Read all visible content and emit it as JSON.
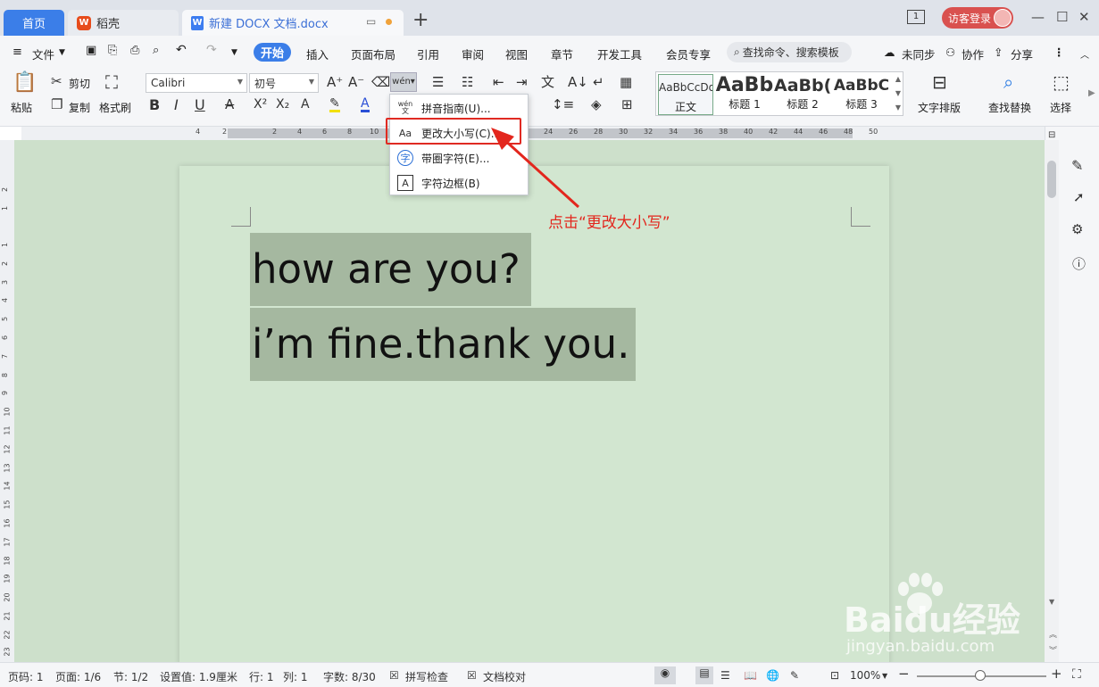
{
  "titlebar": {
    "tab_home": "首页",
    "tab_wps": "稻壳",
    "tab_doc": "新建 DOCX 文档.docx",
    "login": "访客登录",
    "window_num": "1"
  },
  "menu": {
    "file": "文件",
    "items": [
      "开始",
      "插入",
      "页面布局",
      "引用",
      "审阅",
      "视图",
      "章节",
      "开发工具",
      "会员专享"
    ],
    "search_placeholder": "查找命令、搜索模板",
    "sync": "未同步",
    "collab": "协作",
    "share": "分享"
  },
  "ribbon": {
    "paste": "粘贴",
    "cut": "剪切",
    "copy": "复制",
    "format_painter": "格式刷",
    "font_name": "Calibri",
    "font_size": "初号",
    "bold": "B",
    "italic": "I",
    "underline": "U",
    "styles": [
      {
        "preview": "AaBbCcDd",
        "name": "正文"
      },
      {
        "preview": "AaBb",
        "name": "标题 1"
      },
      {
        "preview": "AaBb(",
        "name": "标题 2"
      },
      {
        "preview": "AaBbC",
        "name": "标题 3"
      }
    ],
    "text_layout": "文字排版",
    "find_replace": "查找替换",
    "select": "选择"
  },
  "dropdown": {
    "items": [
      {
        "icon": "wén 文",
        "label": "拼音指南(U)..."
      },
      {
        "icon": "Aa",
        "label": "更改大小写(C)..."
      },
      {
        "icon": "字",
        "label": "带圈字符(E)..."
      },
      {
        "icon": "A",
        "label": "字符边框(B)"
      }
    ]
  },
  "annotation": "点击“更改大小写”",
  "document": {
    "lines": [
      "how are you?",
      "i’m fine.thank you."
    ]
  },
  "ruler": {
    "top": [
      "4",
      "2",
      "2",
      "4",
      "6",
      "8",
      "10",
      "24",
      "26",
      "28",
      "30",
      "32",
      "34",
      "36",
      "38",
      "40",
      "42",
      "44",
      "46",
      "48",
      "50"
    ],
    "left": [
      "2",
      "1",
      "1",
      "2",
      "3",
      "4",
      "5",
      "6",
      "7",
      "8",
      "9",
      "10",
      "11",
      "12",
      "13",
      "14",
      "15",
      "16",
      "17",
      "18",
      "19",
      "20",
      "21",
      "22",
      "23"
    ]
  },
  "status": {
    "page_no": "页码: 1",
    "pages": "页面: 1/6",
    "section": "节: 1/2",
    "setting": "设置值: 1.9厘米",
    "row": "行: 1",
    "col": "列: 1",
    "words": "字数: 8/30",
    "spell": "拼写检查",
    "proof": "文档校对",
    "zoom": "100%"
  },
  "watermark": {
    "brand": "Baidu经验",
    "url": "jingyan.baidu.com"
  },
  "colors": {
    "accent": "#3b7ee8",
    "highlight_red": "#e02a22",
    "doc_bg": "#d2e6d0",
    "selection": "#a5b8a0"
  }
}
